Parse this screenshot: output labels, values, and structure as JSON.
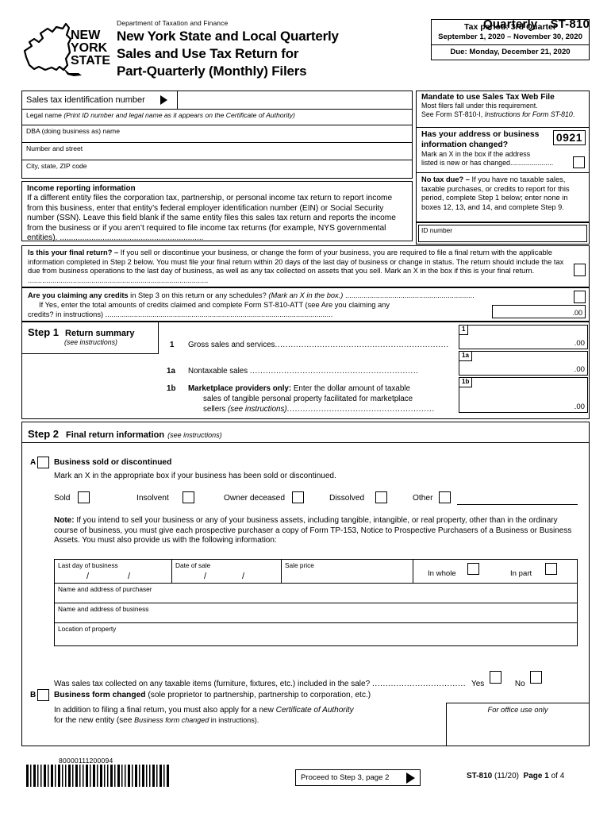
{
  "header": {
    "department": "Department of Taxation and Finance",
    "form_title_lines": [
      "New York State and Local Quarterly",
      "Sales and Use Tax Return for",
      "Part-Quarterly (Monthly) Filers"
    ],
    "quarterly_label": "Quarterly",
    "form_number": "ST-810",
    "logo_text": [
      "NEW",
      "YORK",
      "STATE"
    ],
    "period": {
      "line1": "Tax period: 3rd Quarter",
      "line2": "September 1, 2020 – November 30, 2020",
      "due": "Due: Monday, December 21, 2020"
    }
  },
  "identity_fields": {
    "sales_tax_id_label": "Sales tax identification number",
    "sales_tax_id_value": "",
    "legal_name_label": "Legal name",
    "legal_name_note": "(Print ID number and legal name as it appears on the Certificate of Authority)",
    "legal_name_value": "",
    "dba_label": "DBA (doing business as) name",
    "dba_value": "",
    "street_label": "Number and street",
    "street_value": "",
    "city_label": "City, state, ZIP code",
    "city_value": ""
  },
  "income_reporting": {
    "heading": "Income reporting information",
    "body": "If a different entity files the corporation tax, partnership, or personal income tax return to report income from this business, enter that entity’s federal employer identification number (EIN) or Social Security number (SSN). Leave this field blank if the same entity files this sales tax return and reports the income from the business or if you aren’t required to file income tax returns (for example, NYS governmental entities). ................................................................"
  },
  "mandate": {
    "title": "Mandate to use Sales Tax Web File",
    "line1": "Most filers fall under this requirement.",
    "line2_prefix": "See Form ST-810-I, ",
    "line2_italic": "Instructions for Form ST-810",
    "line2_suffix": "."
  },
  "address_changed": {
    "title_line1": "Has your address or business",
    "title_line2": "information changed?",
    "sub_line1": "Mark an X in the box if the address",
    "sub_line2": "listed is new or has changed......................",
    "code": "0921"
  },
  "no_tax_due": {
    "bold": "No tax due? – ",
    "text": "If you have no taxable sales, taxable purchases, or credits to report for this period, complete Step 1 below; enter none in boxes 12, 13, and 14, and complete Step 9."
  },
  "id_number": {
    "label": "ID number",
    "value": ""
  },
  "final_return": {
    "bold": "Is this your final return? – ",
    "text": "If you sell or discontinue your business, or change the form of your business, you are required to file a final return with the applicable information completed in Step 2 below. You must file your final return within 20 days of the last day of business or change in status. The return should include the tax due from business operations to the last day of business, as well as any tax collected on assets that you sell. Mark an X in the box if this is your final return. ........................................................................................"
  },
  "claiming_credits": {
    "bold": "Are you claiming any credits",
    "rest": " in Step 3 on this return or any schedules? ",
    "italic": "(Mark an X in the box.)",
    "dots": " ...............................................................",
    "line2": "If Yes, enter the total amounts of credits claimed and complete Form ST-810-ATT (see Are you claiming any",
    "line3": "credits? in instructions) ...............................................................................................................",
    "amount_value": ".00"
  },
  "step1": {
    "step_label": "Step 1",
    "title": "Return summary",
    "see_instructions": "(see instructions)",
    "lines": [
      {
        "no": "1",
        "text": "Gross sales and services",
        "dots": "..................................................................",
        "box_tag": "1",
        "decimals": ".00"
      },
      {
        "no": "1a",
        "text": "Nontaxable sales ",
        "dots": "................................................................",
        "box_tag": "1a",
        "decimals": ".00"
      },
      {
        "no": "1b",
        "bold_prefix": "Marketplace providers only:",
        "text": " Enter the dollar amount of taxable",
        "text2": "sales of tangible personal property facilitated for marketplace",
        "text3": "sellers ",
        "italic3": "(see instructions)",
        "dots": "........................................................",
        "box_tag": "1b",
        "decimals": ".00"
      }
    ]
  },
  "step2": {
    "step_label": "Step 2",
    "title": "Final return information",
    "see_instructions": "(see instructions)",
    "section_a": {
      "letter": "A",
      "heading": "Business sold or discontinued",
      "sub": "Mark an X in the appropriate box if your business has been sold or discontinued.",
      "options": [
        "Sold",
        "Insolvent",
        "Owner deceased",
        "Dissolved",
        "Other"
      ],
      "other_value": ""
    },
    "note": {
      "bold": "Note: ",
      "text": "If you intend to sell your business or any of your business assets, including tangible, intangible, or real property, other than in the ordinary course of business, you must give each prospective purchaser a copy of Form TP-153, Notice to Prospective Purchasers of a Business or Business Assets. You must also provide us with the following information:"
    },
    "sale_table": {
      "last_day_label": "Last day of business",
      "date_of_sale_label": "Date of sale",
      "sale_price_label": "Sale price",
      "in_whole_label": "In whole",
      "in_part_label": "In part",
      "purchaser_label": "Name and address of purchaser",
      "business_label": "Name and address of business",
      "property_label": "Location of property",
      "last_day_value": "",
      "date_of_sale_value": "",
      "sale_price_value": "",
      "purchaser_value": "",
      "business_value": "",
      "property_value": ""
    },
    "sales_tax_question": {
      "text": "Was sales tax collected on any taxable items (furniture, fixtures, etc.) included in the sale? ",
      "dots": "...................................",
      "yes": "Yes",
      "no": "No"
    },
    "section_b": {
      "letter": "B",
      "heading_bold": "Business form changed",
      "heading_rest": " (sole proprietor to partnership, partnership to corporation, etc.)",
      "sub_line1a": "In addition to filing a final return, you must also apply for a new ",
      "sub_line1b": "Certificate of Authority",
      "sub_line2a": "for the new entity (see ",
      "sub_line2b": "Business form changed",
      "sub_line2c": " in instructions)."
    }
  },
  "office_use": "For office use only",
  "footer": {
    "barcode_number": "80000111200094",
    "proceed_label": "Proceed to Step 3, page 2",
    "form_id": "ST-810",
    "revision": "(11/20)",
    "page_label": "Page 1",
    "page_of": " of 4"
  }
}
